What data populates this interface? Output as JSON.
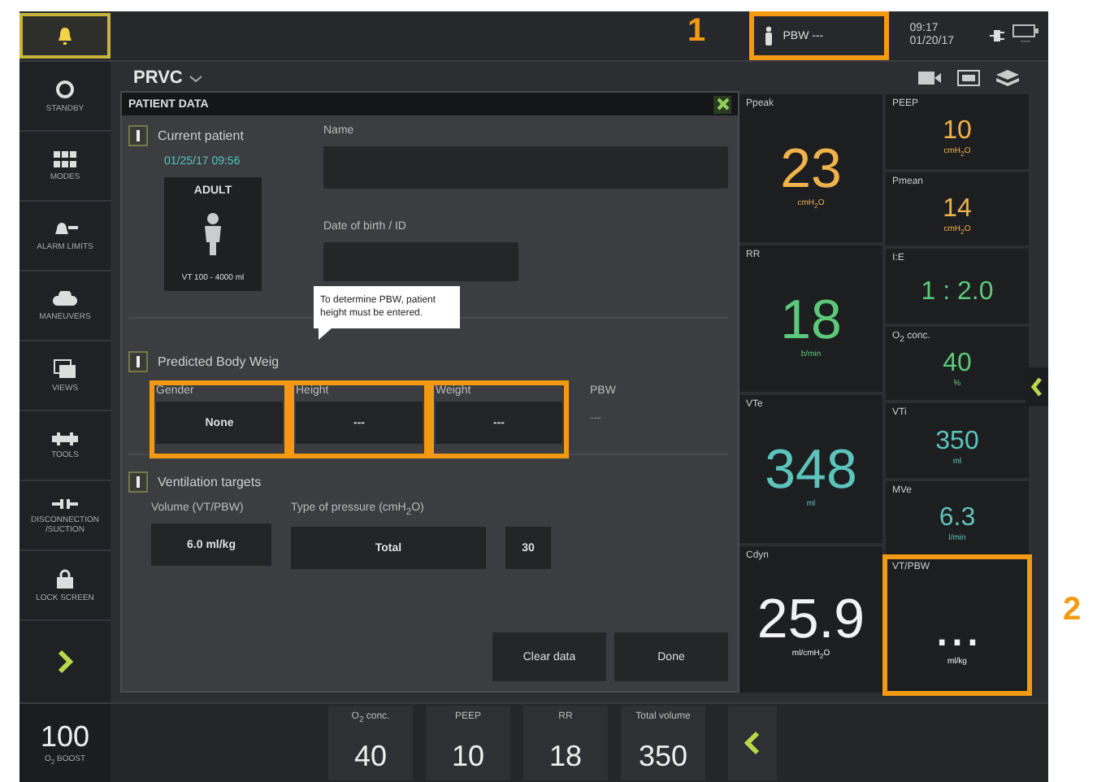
{
  "top_bar": {
    "pbw_indicator": {
      "label": "PBW",
      "value": "---",
      "highlighted": true
    },
    "time": "09:17",
    "date": "01/20/17",
    "battery_reading": "---"
  },
  "sidebar": {
    "items": [
      {
        "label": "STANDBY",
        "kind": "standby"
      },
      {
        "label": "MODES",
        "kind": "modes"
      },
      {
        "label": "ALARM LIMITS",
        "kind": "alarms"
      },
      {
        "label": "MANEUVERS",
        "kind": "maneuvers"
      },
      {
        "label": "VIEWS",
        "kind": "views"
      },
      {
        "label": "TOOLS",
        "kind": "tools"
      },
      {
        "label": "DISCONNECTION /SUCTION",
        "kind": "suction"
      },
      {
        "label": "LOCK SCREEN",
        "kind": "lock"
      }
    ]
  },
  "mode": "PRVC",
  "dialog": {
    "title": "PATIENT DATA",
    "current_patient": {
      "heading": "Current patient",
      "timestamp": "01/25/17 09:56",
      "category": "ADULT",
      "range": "VT 100 - 4000 ml"
    },
    "name": {
      "label": "Name"
    },
    "birth_id": {
      "label": "Date of birth / ID"
    },
    "pbw_section": {
      "heading": "Predicted Body Weig",
      "tooltip": "To determine PBW, patient height must be entered.",
      "fields": [
        {
          "label": "Gender",
          "value": "None",
          "highlighted": true,
          "kind": "box"
        },
        {
          "label": "Height",
          "value": "---",
          "highlighted": true,
          "kind": "box"
        },
        {
          "label": "Weight",
          "value": "---",
          "highlighted": true,
          "kind": "box"
        },
        {
          "label": "PBW",
          "value": "---",
          "highlighted": false,
          "kind": "plain"
        }
      ]
    },
    "targets": {
      "heading": "Ventilation targets",
      "volume_label": "Volume (VT/PBW)",
      "pressure_label": "Type of pressure (cmH$_{2}$O)",
      "volume": "6.0 ml/kg",
      "pressure_type": "Total",
      "pressure_value": "30"
    },
    "buttons": [
      "Clear data",
      "Done"
    ]
  },
  "monitor": {
    "columns": [
      {
        "tiles": [
          {
            "name": "Ppeak",
            "value": "23",
            "unit": "cmH$_{2}$O",
            "color": "#f0b24a",
            "kind": "big"
          },
          {
            "name": "RR",
            "value": "18",
            "unit": "b/min",
            "color": "#5cc97a",
            "kind": "big"
          },
          {
            "name": "VTe",
            "value": "348",
            "unit": "ml",
            "color": "#5cc4bd",
            "kind": "big"
          },
          {
            "name": "Cdyn",
            "value": "25.9",
            "unit": "ml/cmH$_{2}$O",
            "color": "#f2f2f2",
            "kind": "big"
          }
        ]
      },
      {
        "tiles": [
          {
            "name": "PEEP",
            "value": "10",
            "unit": "cmH$_{2}$O",
            "color": "#f0b24a",
            "kind": "small"
          },
          {
            "name": "Pmean",
            "value": "14",
            "unit": "cmH$_{2}$O",
            "color": "#f0b24a",
            "kind": "small"
          },
          {
            "name": "I:E",
            "value": "1 : 2.0",
            "color": "#5cc97a",
            "kind": "small"
          },
          {
            "name": "O$_{2}$ conc.",
            "value": "40",
            "unit": "%",
            "color": "#5cc97a",
            "kind": "small"
          },
          {
            "name": "VTi",
            "value": "350",
            "unit": "ml",
            "color": "#5cc4bd",
            "kind": "small"
          },
          {
            "name": "MVe",
            "value": "6.3",
            "unit": "l/min",
            "color": "#5cc4bd",
            "kind": "small"
          },
          {
            "name": "VT/PBW",
            "value": "...",
            "unit": "ml/kg",
            "color": "#f2f2f2",
            "kind": "big",
            "highlighted": true
          }
        ]
      }
    ]
  },
  "bottom_bar": {
    "boost": {
      "value": "100",
      "label": "O$_{2}$ BOOST"
    },
    "settings": [
      {
        "label": "O$_{2}$ conc.",
        "value": "40"
      },
      {
        "label": "PEEP",
        "value": "10"
      },
      {
        "label": "RR",
        "value": "18"
      },
      {
        "label": "Total volume",
        "value": "350"
      }
    ]
  },
  "annotations": [
    {
      "label": "1"
    },
    {
      "label": "2"
    }
  ]
}
